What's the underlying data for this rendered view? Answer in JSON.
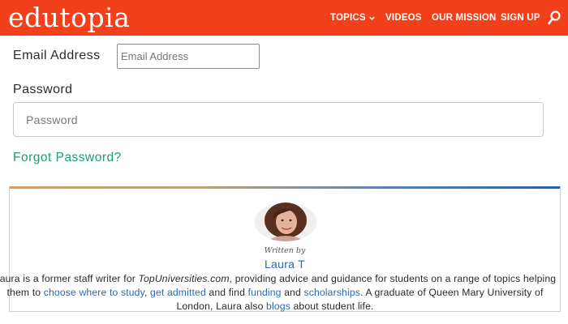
{
  "header": {
    "logo": "edutopia",
    "nav": [
      {
        "label": "TOPICS"
      },
      {
        "label": "VIDEOS"
      },
      {
        "label": "OUR MISSION"
      },
      {
        "label": "SIGN UP"
      }
    ],
    "icons": {
      "search": "search-icon",
      "topics_chevron": "chevron-down-icon"
    }
  },
  "form": {
    "email_label": "Email Address",
    "email_placeholder": "Email Address",
    "password_label": "Password",
    "password_placeholder": "Password",
    "forgot": "Forgot Password?"
  },
  "author": {
    "written_by": "Written by",
    "name": "Laura T",
    "bio": {
      "p1": "Laura is a former staff writer for ",
      "site": "TopUniversities.com",
      "p2": ", providing advice and guidance for students on a range of topics helping them to ",
      "link_study": "choose where to study",
      "p3": ", ",
      "link_admitted": "get admitted",
      "p4": " and find ",
      "link_funding": "funding",
      "p5": " and ",
      "link_scholarships": "scholarships",
      "p6": ". A graduate of Queen Mary University of London, Laura also ",
      "link_blogs": "blogs",
      "p7": " about student life."
    }
  },
  "colors": {
    "header_bg": "#f2401c",
    "link": "#2a67b1",
    "forgot": "#1aa06e"
  }
}
